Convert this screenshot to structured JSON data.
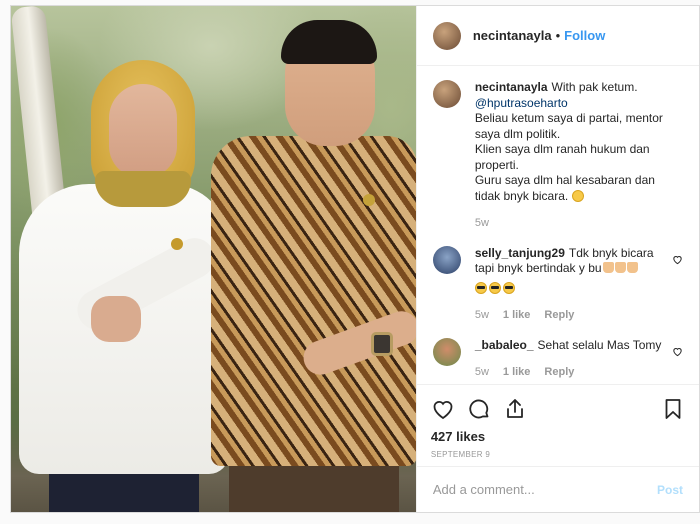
{
  "post": {
    "username": "necintanayla",
    "follow_label": "Follow",
    "separator": "•"
  },
  "caption": {
    "username": "necintanayla",
    "first_line": "With pak ketum.",
    "mention": "@hputrasoeharto",
    "lines": [
      "Beliau ketum saya di partai, mentor saya dlm politik.",
      "Klien saya dlm ranah hukum dan properti.",
      "Guru saya dlm hal kesabaran dan tidak bnyk bicara."
    ],
    "emoji": "smiling-face-emoji",
    "time": "5w"
  },
  "comments": [
    {
      "username": "selly_tanjung29",
      "text": "Tdk bnyk bicara tapi bnyk bertindak y bu",
      "emoji_after": [
        "thumbs-up-emoji",
        "thumbs-up-emoji",
        "thumbs-up-emoji"
      ],
      "emoji_line": [
        "sunglasses-emoji",
        "sunglasses-emoji",
        "sunglasses-emoji"
      ],
      "time": "5w",
      "likes": "1 like",
      "reply": "Reply"
    },
    {
      "username": "_babaleo_",
      "text": "Sehat selalu Mas Tomy",
      "time": "5w",
      "likes": "1 like",
      "reply": "Reply"
    }
  ],
  "stats": {
    "likes": "427 likes",
    "date": "September 9"
  },
  "add_comment": {
    "placeholder": "Add a comment...",
    "post_label": "Post"
  },
  "colors": {
    "accent": "#3897f0",
    "post_disabled": "#b2dffc",
    "muted": "#999999",
    "text": "#262626"
  }
}
